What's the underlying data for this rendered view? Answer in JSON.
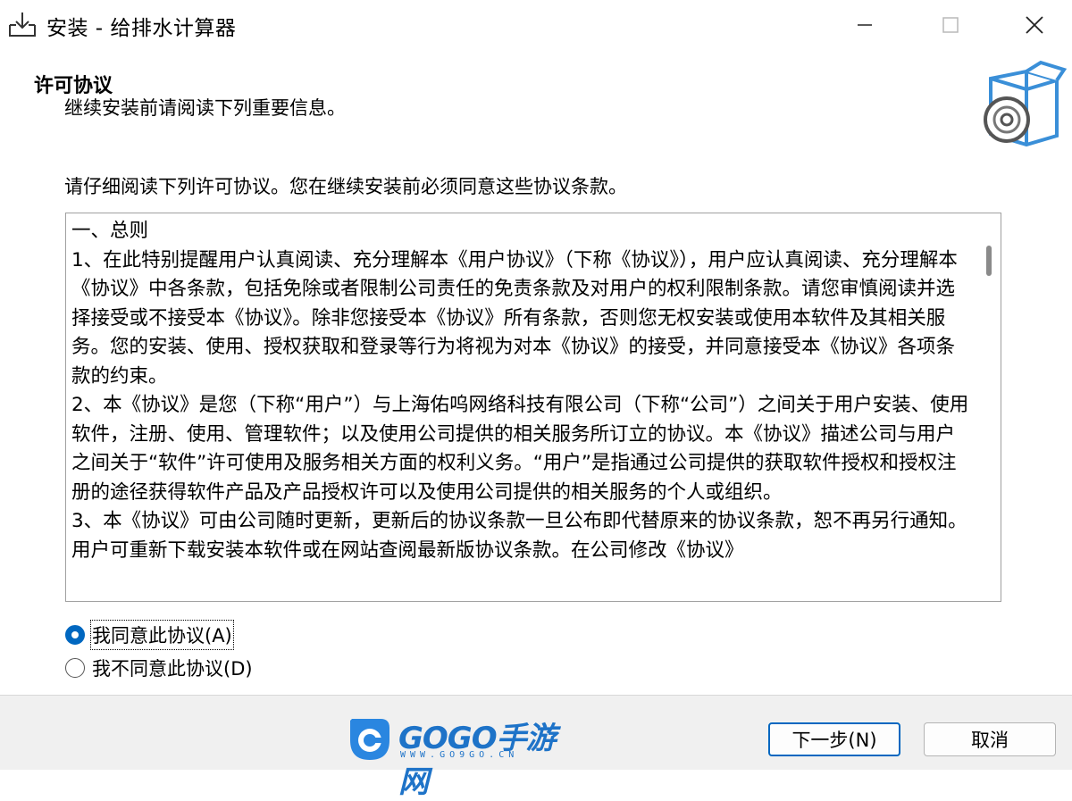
{
  "window": {
    "title": "安装 - 给排水计算器",
    "icons": {
      "app": "download-tray-icon",
      "minimize": "minimize-icon",
      "maximize": "maximize-icon",
      "close": "close-icon"
    }
  },
  "header": {
    "heading": "许可协议",
    "subheading": "继续安装前请阅读下列重要信息。",
    "icon": "setup-box-disc-icon"
  },
  "instruction": "请仔细阅读下列许可协议。您在继续安装前必须同意这些协议条款。",
  "license": {
    "text": "一、总则\n1、在此特别提醒用户认真阅读、充分理解本《用户协议》（下称《协议》），用户应认真阅读、充分理解本《协议》中各条款，包括免除或者限制公司责任的免责条款及对用户的权利限制条款。请您审慎阅读并选择接受或不接受本《协议》。除非您接受本《协议》所有条款，否则您无权安装或使用本软件及其相关服务。您的安装、使用、授权获取和登录等行为将视为对本《协议》的接受，并同意接受本《协议》各项条款的约束。\n2、本《协议》是您（下称“用户”）与上海佑呜网络科技有限公司（下称“公司”）之间关于用户安装、使用软件，注册、使用、管理软件；以及使用公司提供的相关服务所订立的协议。本《协议》描述公司与用户之间关于“软件”许可使用及服务相关方面的权利义务。“用户”是指通过公司提供的获取软件授权和授权注册的途径获得软件产品及产品授权许可以及使用公司提供的相关服务的个人或组织。\n3、本《协议》可由公司随时更新，更新后的协议条款一旦公布即代替原来的协议条款，恕不再另行通知。用户可重新下载安装本软件或在网站查阅最新版协议条款。在公司修改《协议》"
  },
  "options": {
    "accept": "我同意此协议(A)",
    "decline": "我不同意此协议(D)",
    "selected": "accept"
  },
  "footer": {
    "logo_text": "GOGO手游网",
    "logo_url": "WWW.GO9GO.CN",
    "next_label": "下一步(N)",
    "cancel_label": "取消"
  }
}
